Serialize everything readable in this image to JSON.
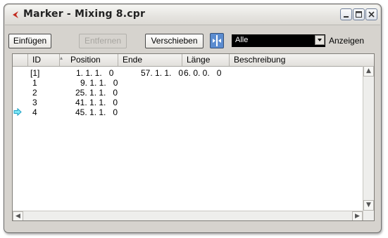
{
  "window": {
    "title": "Marker - Mixing 8.cpr",
    "buttons": [
      "minimize",
      "maximize",
      "close"
    ]
  },
  "toolbar": {
    "insert_label": "Einfügen",
    "remove_label": "Entfernen",
    "move_label": "Verschieben",
    "move_icon": "cycle-marker-icon",
    "filter_value": "Alle",
    "show_label": "Anzeigen"
  },
  "columns": [
    "ID",
    "Position",
    "Ende",
    "Länge",
    "Beschreibung"
  ],
  "rows": [
    {
      "id": "[1]",
      "position": "1. 1. 1.   0",
      "end": "57. 1. 1.   0",
      "length": "6. 0. 0.   0",
      "description": "",
      "current": false
    },
    {
      "id": "1",
      "position": "9. 1. 1.   0",
      "end": "",
      "length": "",
      "description": "",
      "current": false
    },
    {
      "id": "2",
      "position": "25. 1. 1.   0",
      "end": "",
      "length": "",
      "description": "",
      "current": false
    },
    {
      "id": "3",
      "position": "41. 1. 1.   0",
      "end": "",
      "length": "",
      "description": "",
      "current": false
    },
    {
      "id": "4",
      "position": "45. 1. 1.   0",
      "end": "",
      "length": "",
      "description": "",
      "current": true
    }
  ],
  "colors": {
    "accent": "#2e8bd6",
    "current_marker": "#1ec6e6",
    "window_bg": "#d6d3ce"
  }
}
